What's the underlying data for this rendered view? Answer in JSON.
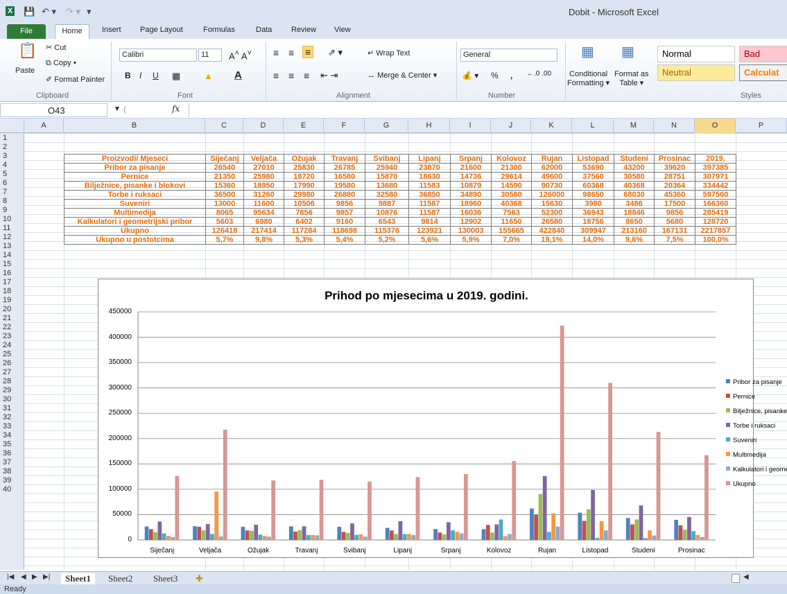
{
  "window": {
    "title": "Dobit - Microsoft Excel"
  },
  "tabs": [
    "File",
    "Home",
    "Insert",
    "Page Layout",
    "Formulas",
    "Data",
    "Review",
    "View"
  ],
  "ribbon": {
    "clipboard": {
      "paste": "Paste",
      "cut": "Cut",
      "copy": "Copy",
      "format_painter": "Format Painter",
      "label": "Clipboard"
    },
    "font": {
      "name": "Calibri",
      "size": "11",
      "bold": "B",
      "italic": "I",
      "underline": "U",
      "label": "Font"
    },
    "alignment": {
      "wrap": "Wrap Text",
      "merge": "Merge & Center",
      "label": "Alignment"
    },
    "number": {
      "format": "General",
      "percent": "%",
      "comma": ",",
      "label": "Number"
    },
    "styles": {
      "conditional": "Conditional",
      "formatting": "Formatting",
      "format_as": "Format as",
      "table": "Table",
      "normal": "Normal",
      "bad": "Bad",
      "neutral": "Neutral",
      "calculation": "Calculat",
      "label": "Styles"
    }
  },
  "formula_bar": {
    "name_box": "O43",
    "fx": "fx",
    "formula": ""
  },
  "columns": [
    "A",
    "B",
    "C",
    "D",
    "E",
    "F",
    "G",
    "H",
    "I",
    "J",
    "K",
    "L",
    "M",
    "N",
    "O",
    "P"
  ],
  "rows": [
    "1",
    "2",
    "3",
    "4",
    "5",
    "6",
    "7",
    "8",
    "9",
    "10",
    "11",
    "12",
    "13",
    "14",
    "15",
    "16",
    "17",
    "18",
    "19",
    "20",
    "21",
    "22",
    "23",
    "24",
    "25",
    "26",
    "27",
    "28",
    "29",
    "30",
    "31",
    "32",
    "33",
    "34",
    "35",
    "36",
    "37",
    "38",
    "39",
    "40"
  ],
  "table": {
    "header": [
      "Proizvodi/ Mjeseci",
      "Siječanj",
      "Veljača",
      "Ožujak",
      "Travanj",
      "Svibanj",
      "Lipanj",
      "Srpanj",
      "Kolovoz",
      "Rujan",
      "Listopad",
      "Studeni",
      "Prosinac",
      "2019."
    ],
    "rows": [
      [
        "Pribor za pisanje",
        "26540",
        "27010",
        "25830",
        "26785",
        "25940",
        "23870",
        "21600",
        "21300",
        "62000",
        "53690",
        "43200",
        "39620",
        "397385"
      ],
      [
        "Pernice",
        "21350",
        "25980",
        "18720",
        "16580",
        "15870",
        "18630",
        "14736",
        "29614",
        "49600",
        "37560",
        "30580",
        "28751",
        "307971"
      ],
      [
        "Bilježnice, pisanke i blokovi",
        "15360",
        "18950",
        "17990",
        "19580",
        "13680",
        "11583",
        "10879",
        "14590",
        "90730",
        "60368",
        "40368",
        "20364",
        "334442"
      ],
      [
        "Torbe i ruksaci",
        "36500",
        "31260",
        "29980",
        "26880",
        "32580",
        "36850",
        "34890",
        "30580",
        "126000",
        "98650",
        "68030",
        "45360",
        "597560"
      ],
      [
        "Suveniri",
        "13000",
        "11600",
        "10506",
        "9856",
        "9887",
        "11587",
        "18960",
        "40368",
        "15630",
        "3980",
        "3486",
        "17500",
        "166360"
      ],
      [
        "Multimedija",
        "8065",
        "95634",
        "7856",
        "9857",
        "10876",
        "11587",
        "16036",
        "7563",
        "52300",
        "36943",
        "18846",
        "9856",
        "285419"
      ],
      [
        "Kalkulatori i geometrijski pribor",
        "5603",
        "6980",
        "6402",
        "9160",
        "6543",
        "9814",
        "12902",
        "11650",
        "26580",
        "18756",
        "8650",
        "5680",
        "128720"
      ],
      [
        "Ukupno",
        "126418",
        "217414",
        "117284",
        "118698",
        "115376",
        "123921",
        "130003",
        "155665",
        "422840",
        "309947",
        "213160",
        "167131",
        "2217857"
      ],
      [
        "Ukupno u postotcima",
        "5,7%",
        "9,8%",
        "5,3%",
        "5,4%",
        "5,2%",
        "5,6%",
        "5,9%",
        "7,0%",
        "19,1%",
        "14,0%",
        "9,6%",
        "7,5%",
        "100,0%"
      ]
    ]
  },
  "chart_data": {
    "type": "bar",
    "title": "Prihod po mjesecima u 2019. godini.",
    "categories": [
      "Siječanj",
      "Veljača",
      "Ožujak",
      "Travanj",
      "Svibanj",
      "Lipanj",
      "Srpanj",
      "Kolovoz",
      "Rujan",
      "Listopad",
      "Studeni",
      "Prosinac"
    ],
    "ylim": [
      0,
      450000
    ],
    "yticks": [
      "0",
      "50000",
      "100000",
      "150000",
      "200000",
      "250000",
      "300000",
      "350000",
      "400000",
      "450000"
    ],
    "grid": true,
    "legend": "right",
    "series": [
      {
        "name": "Pribor za pisanje",
        "color": "#4f81bd",
        "values": [
          26540,
          27010,
          25830,
          26785,
          25940,
          23870,
          21600,
          21300,
          62000,
          53690,
          43200,
          39620
        ]
      },
      {
        "name": "Pernice",
        "color": "#c0504d",
        "values": [
          21350,
          25980,
          18720,
          16580,
          15870,
          18630,
          14736,
          29614,
          49600,
          37560,
          30580,
          28751
        ]
      },
      {
        "name": "Bilježnice, pisanke i blokovi",
        "color": "#9bbb59",
        "values": [
          15360,
          18950,
          17990,
          19580,
          13680,
          11583,
          10879,
          14590,
          90730,
          60368,
          40368,
          20364
        ]
      },
      {
        "name": "Torbe i ruksaci",
        "color": "#8064a2",
        "values": [
          36500,
          31260,
          29980,
          26880,
          32580,
          36850,
          34890,
          30580,
          126000,
          98650,
          68030,
          45360
        ]
      },
      {
        "name": "Suveniri",
        "color": "#4bacc6",
        "values": [
          13000,
          11600,
          10506,
          9856,
          9887,
          11587,
          18960,
          40368,
          15630,
          3980,
          3486,
          17500
        ]
      },
      {
        "name": "Multimedija",
        "color": "#f79646",
        "values": [
          8065,
          95634,
          7856,
          9857,
          10876,
          11587,
          16036,
          7563,
          52300,
          36943,
          18846,
          9856
        ]
      },
      {
        "name": "Kalkulatori i geometrijski pribor",
        "color": "#8fa9cf",
        "values": [
          5603,
          6980,
          6402,
          9160,
          6543,
          9814,
          12902,
          11650,
          26580,
          18756,
          8650,
          5680
        ]
      },
      {
        "name": "Ukupno",
        "color": "#d99694",
        "values": [
          126418,
          217414,
          117284,
          118698,
          115376,
          123921,
          130003,
          155665,
          422840,
          309947,
          213160,
          167131
        ]
      }
    ]
  },
  "sheets": [
    "Sheet1",
    "Sheet2",
    "Sheet3"
  ],
  "status": {
    "text": "Ready"
  }
}
